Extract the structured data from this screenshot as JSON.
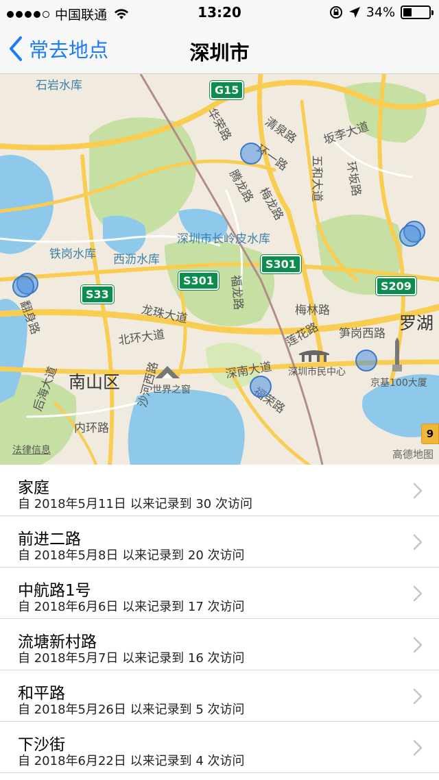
{
  "status_bar": {
    "carrier": "中国联通",
    "time": "13:20",
    "battery": "34%",
    "battery_level": 0.34
  },
  "nav": {
    "back_label": "常去地点",
    "title": "深圳市"
  },
  "map": {
    "labels": {
      "shiyan": "石岩水库",
      "tiegang": "铁岗水库",
      "xili": "西沥水库",
      "changling": "深圳市长岭皮水库",
      "qingquan": "清泉路",
      "huanhuan": "环一路",
      "meilong": "梅龙路",
      "tenglong": "腾龙路",
      "wuhe": "五和大道",
      "banli": "坂李大道",
      "huarong": "华荣路",
      "fuhuo": "福龙路",
      "meilin": "梅林路",
      "lianhua": "莲花路",
      "sungang": "笋岗西路",
      "luohu": "罗湖",
      "longzhu": "龙珠大道",
      "beihuan": "北环大道",
      "shennan": "深南大道",
      "civic": "深圳市民中心",
      "kingkey": "京基100大厦",
      "nanshan": "南山区",
      "shahe": "沙河西路",
      "window": "世界之窗",
      "neihuan": "内环路",
      "fanshen": "翻身路",
      "hourhai": "后海大道",
      "fuhuan": "福荣路",
      "bantian": "环坂路"
    },
    "shields": {
      "g15": "G15",
      "s33": "S33",
      "s301a": "S301",
      "s301b": "S301",
      "s209": "S209"
    },
    "legal": "法律信息",
    "attribution": "高德地图",
    "road_badge": "9"
  },
  "places": [
    {
      "name": "家庭",
      "detail": "自 2018年5月11日 以来记录到 30 次访问"
    },
    {
      "name": "前进二路",
      "detail": "自 2018年5月8日 以来记录到 20 次访问"
    },
    {
      "name": "中航路1号",
      "detail": "自 2018年6月6日 以来记录到 17 次访问"
    },
    {
      "name": "流塘新村路",
      "detail": "自 2018年5月7日 以来记录到 16 次访问"
    },
    {
      "name": "和平路",
      "detail": "自 2018年5月26日 以来记录到 5 次访问"
    },
    {
      "name": "下沙街",
      "detail": "自 2018年6月22日 以来记录到 4 次访问"
    }
  ],
  "colors": {
    "accent": "#1a7cf6",
    "water": "#8ec9ec",
    "park": "#c6dfa3",
    "road": "#f9cd52",
    "shield": "#0d8c4f"
  }
}
